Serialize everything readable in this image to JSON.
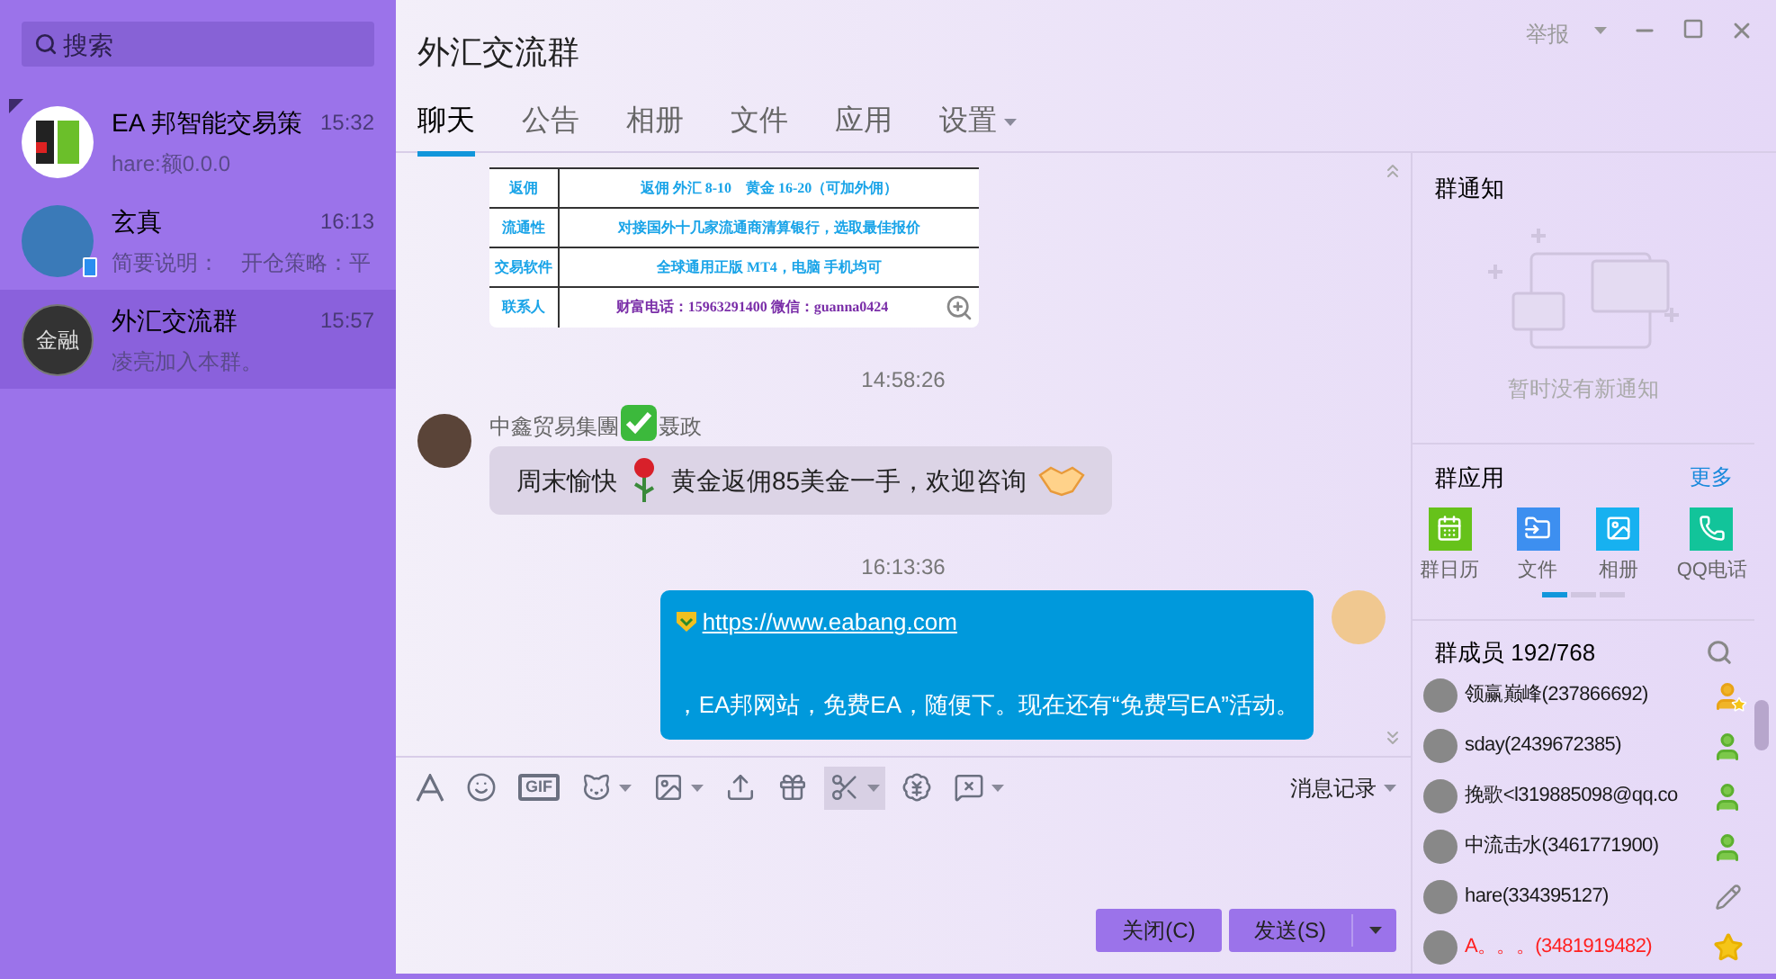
{
  "sidebar": {
    "search": {
      "placeholder": "搜索"
    },
    "contacts": [
      {
        "name": "EA 邦智能交易策",
        "time": "15:32",
        "preview": "hare:额0.0.0",
        "selected": false,
        "pinned": true,
        "mobile": false,
        "kind": "logo"
      },
      {
        "name": "玄真",
        "time": "16:13",
        "preview": "简要说明：　开仓策略：平",
        "selected": false,
        "pinned": false,
        "mobile": true,
        "kind": "photo"
      },
      {
        "name": "外汇交流群",
        "time": "15:57",
        "preview": "凌亮加入本群。",
        "selected": true,
        "pinned": false,
        "mobile": false,
        "kind": "text",
        "avatar_text": "金融"
      }
    ]
  },
  "window": {
    "title": "外汇交流群",
    "report": "举报"
  },
  "tabs": [
    {
      "label": "聊天",
      "selected": true,
      "dropdown": false
    },
    {
      "label": "公告",
      "selected": false,
      "dropdown": false
    },
    {
      "label": "相册",
      "selected": false,
      "dropdown": false
    },
    {
      "label": "文件",
      "selected": false,
      "dropdown": false
    },
    {
      "label": "应用",
      "selected": false,
      "dropdown": false
    },
    {
      "label": "设置",
      "selected": false,
      "dropdown": true
    }
  ],
  "chat": {
    "image_table": [
      {
        "label": "返佣",
        "value": "返佣 外汇 8-10　黄金 16-20（可加外佣）",
        "kind": "normal"
      },
      {
        "label": "流通性",
        "value": "对接国外十几家流通商清算银行，选取最佳报价",
        "kind": "normal"
      },
      {
        "label": "交易软件",
        "value": "全球通用正版 MT4，电脑 手机均可",
        "kind": "normal"
      },
      {
        "label": "联系人",
        "value": "财富电话：15963291400 微信：guanna0424",
        "kind": "contact"
      }
    ],
    "messages": [
      {
        "kind": "incoming",
        "time": "14:58:26",
        "sender_before": "中鑫贸易集團",
        "sender_after": "聂政",
        "parts": [
          {
            "kind": "text",
            "text": "周末愉快"
          },
          {
            "kind": "rose"
          },
          {
            "kind": "text",
            "text": "黄金返佣85美金一手，欢迎咨询"
          },
          {
            "kind": "handshake"
          }
        ]
      },
      {
        "kind": "outgoing",
        "time": "16:13:36",
        "link": "https://www.eabang.com",
        "text": "，EA邦网站，免费EA，随便下。现在还有“免费写EA”活动。"
      }
    ]
  },
  "toolbar": {
    "items": [
      {
        "kind": "font",
        "dropdown": false,
        "selected": false
      },
      {
        "kind": "emoji",
        "dropdown": false,
        "selected": false
      },
      {
        "kind": "gif",
        "label": "GIF",
        "dropdown": false,
        "selected": false
      },
      {
        "kind": "cat",
        "dropdown": true,
        "selected": false
      },
      {
        "kind": "image",
        "dropdown": true,
        "selected": false
      },
      {
        "kind": "upload",
        "dropdown": false,
        "selected": false
      },
      {
        "kind": "gift",
        "dropdown": false,
        "selected": false
      },
      {
        "kind": "scissors",
        "dropdown": true,
        "selected": true
      },
      {
        "kind": "red-packet",
        "dropdown": false,
        "selected": false
      },
      {
        "kind": "block",
        "dropdown": true,
        "selected": false
      }
    ],
    "history": "消息记录"
  },
  "buttons": {
    "close": "关闭(C)",
    "send": "发送(S)"
  },
  "notice": {
    "title": "群通知",
    "empty": "暂时没有新通知"
  },
  "apps": {
    "title": "群应用",
    "more": "更多",
    "items": [
      {
        "kind": "calendar",
        "label": "群日历"
      },
      {
        "kind": "file",
        "label": "文件"
      },
      {
        "kind": "album",
        "label": "相册"
      },
      {
        "kind": "phone",
        "label": "QQ电话"
      }
    ],
    "pages": [
      {
        "selected": true
      },
      {
        "selected": false
      },
      {
        "selected": false
      }
    ]
  },
  "members": {
    "title": "群成员 192/768",
    "items": [
      {
        "name": "领赢巅峰(237866692)",
        "kind": "owner",
        "color": "#1a1a1a"
      },
      {
        "name": "sday(2439672385)",
        "kind": "admin",
        "color": "#1a1a1a"
      },
      {
        "name": "挽歌<l319885098@qq.co",
        "kind": "admin",
        "color": "#1a1a1a"
      },
      {
        "name": "中流击水(3461771900)",
        "kind": "admin",
        "color": "#1a1a1a"
      },
      {
        "name": "hare(334395127)",
        "kind": "self",
        "color": "#1a1a1a"
      },
      {
        "name": "A。。。(3481919482)",
        "kind": "vip",
        "color": "#ff2020"
      }
    ]
  }
}
